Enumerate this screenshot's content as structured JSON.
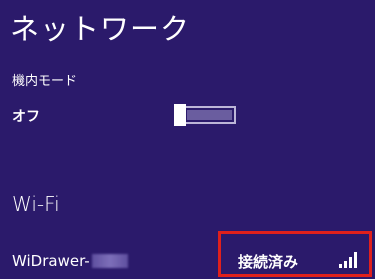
{
  "header": {
    "title": "ネットワーク"
  },
  "airplane_mode": {
    "label": "機内モード",
    "state": "オフ"
  },
  "wifi": {
    "heading": "Wi-Fi",
    "network": {
      "name": "WiDrawer-",
      "status": "接続済み"
    }
  },
  "colors": {
    "background": "#2b1a6b",
    "highlight": "#e0201c",
    "toggle_track": "#6a5d9f"
  },
  "icons": {
    "signal": "signal-strength-icon"
  }
}
